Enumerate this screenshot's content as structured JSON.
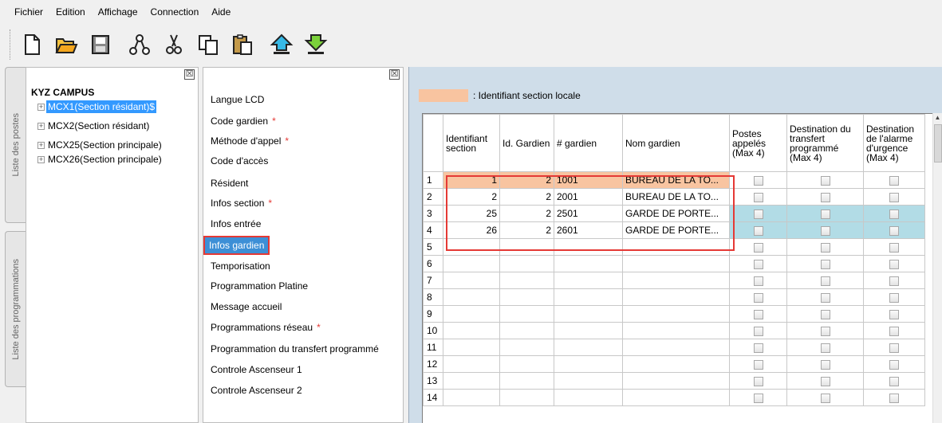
{
  "menu": [
    "Fichier",
    "Edition",
    "Affichage",
    "Connection",
    "Aide"
  ],
  "toolbar": [
    "new-icon",
    "open-icon",
    "save-icon",
    "network-icon",
    "cut-icon",
    "copy-icon",
    "paste-icon",
    "upload-icon",
    "download-icon"
  ],
  "side_tabs": {
    "postes": "Liste des postes",
    "programmations": "Liste des programmations"
  },
  "tree": {
    "close": "☒",
    "root": "KYZ CAMPUS",
    "items": [
      {
        "expander": "+",
        "label": "MCX1(Section résidant)$"
      },
      {
        "expander": "+",
        "label": "MCX2(Section résidant)"
      },
      {
        "expander": "+",
        "label": "MCX25(Section principale)"
      },
      {
        "expander": "+",
        "label": "MCX26(Section principale)"
      }
    ]
  },
  "config_menu": {
    "close": "☒",
    "required_mark": "*",
    "items": [
      {
        "label": "Langue LCD"
      },
      {
        "label": "Code gardien",
        "required": true
      },
      {
        "label": "Méthode d'appel",
        "required": true
      },
      {
        "label": "Code d'accès"
      },
      {
        "label": "Résident"
      },
      {
        "label": "Infos section",
        "required": true
      },
      {
        "label": "Infos entrée"
      },
      {
        "label": "Infos gardien",
        "selected": true
      },
      {
        "label": "Temporisation"
      },
      {
        "label": "Programmation Platine"
      },
      {
        "label": "Message accueil"
      },
      {
        "label": "Programmations réseau",
        "required": true
      },
      {
        "label": "Programmation du transfert programmé"
      },
      {
        "label": "Controle Ascenseur 1"
      },
      {
        "label": "Controle Ascenseur 2"
      }
    ]
  },
  "legend": {
    "text": ": Identifiant section locale",
    "color": "#f8c4a0"
  },
  "grid": {
    "columns": [
      "",
      "Identifiant section",
      "Id. Gardien",
      "# gardien",
      "Nom gardien",
      "Postes appelés (Max 4)",
      "Destination du transfert programmé (Max 4)",
      "Destination de l'alarme d'urgence (Max 4)"
    ],
    "rows": [
      {
        "n": "1",
        "section": "1",
        "id_gardien": "2",
        "gardien": "1001",
        "nom": "BUREAU DE LA TO...",
        "style": "orange"
      },
      {
        "n": "2",
        "section": "2",
        "id_gardien": "2",
        "gardien": "2001",
        "nom": "BUREAU DE LA TO...",
        "style": ""
      },
      {
        "n": "3",
        "section": "25",
        "id_gardien": "2",
        "gardien": "2501",
        "nom": "GARDE DE PORTE...",
        "style": "blue"
      },
      {
        "n": "4",
        "section": "26",
        "id_gardien": "2",
        "gardien": "2601",
        "nom": "GARDE DE PORTE...",
        "style": "blue"
      },
      {
        "n": "5",
        "section": "",
        "id_gardien": "",
        "gardien": "",
        "nom": "",
        "style": ""
      },
      {
        "n": "6",
        "section": "",
        "id_gardien": "",
        "gardien": "",
        "nom": "",
        "style": ""
      },
      {
        "n": "7",
        "section": "",
        "id_gardien": "",
        "gardien": "",
        "nom": "",
        "style": ""
      },
      {
        "n": "8",
        "section": "",
        "id_gardien": "",
        "gardien": "",
        "nom": "",
        "style": ""
      },
      {
        "n": "9",
        "section": "",
        "id_gardien": "",
        "gardien": "",
        "nom": "",
        "style": ""
      },
      {
        "n": "10",
        "section": "",
        "id_gardien": "",
        "gardien": "",
        "nom": "",
        "style": ""
      },
      {
        "n": "11",
        "section": "",
        "id_gardien": "",
        "gardien": "",
        "nom": "",
        "style": ""
      },
      {
        "n": "12",
        "section": "",
        "id_gardien": "",
        "gardien": "",
        "nom": "",
        "style": ""
      },
      {
        "n": "13",
        "section": "",
        "id_gardien": "",
        "gardien": "",
        "nom": "",
        "style": ""
      },
      {
        "n": "14",
        "section": "",
        "id_gardien": "",
        "gardien": "",
        "nom": "",
        "style": ""
      }
    ]
  },
  "colors": {
    "highlight": "#e53935",
    "selection": "#3399ff",
    "row_blue": "#b2dce6"
  }
}
